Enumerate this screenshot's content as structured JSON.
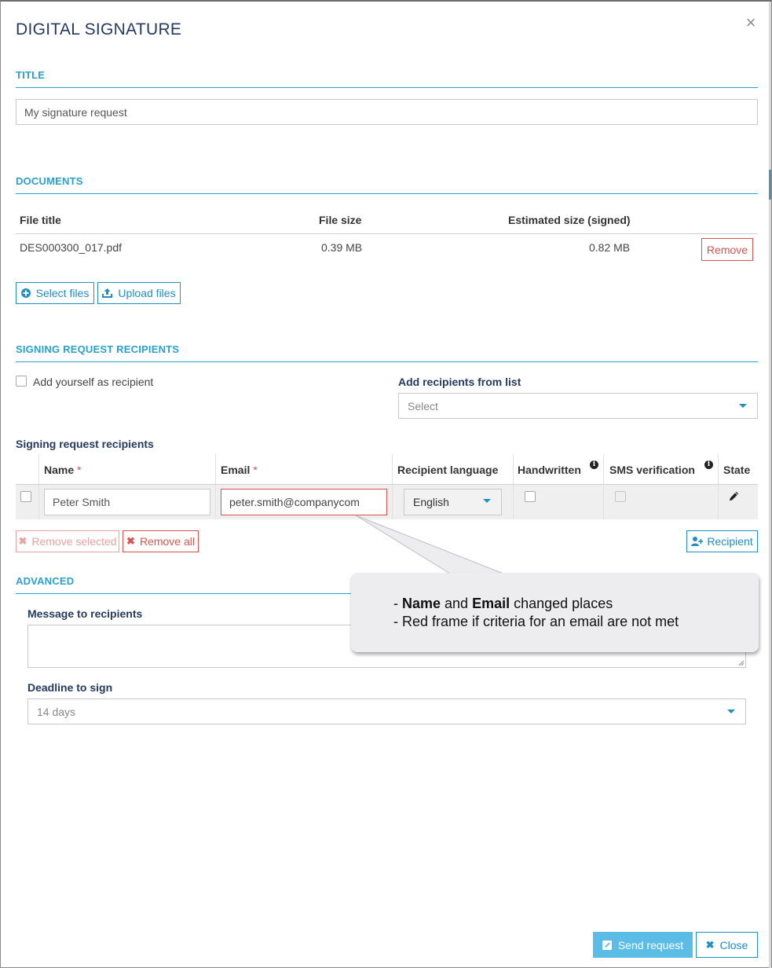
{
  "dialog": {
    "title": "DIGITAL SIGNATURE",
    "close_glyph": "×"
  },
  "title_section": {
    "heading": "TITLE",
    "value": "My signature request"
  },
  "documents": {
    "heading": "DOCUMENTS",
    "columns": {
      "file_title": "File title",
      "file_size": "File size",
      "estimated_size": "Estimated size (signed)"
    },
    "rows": [
      {
        "file_title": "DES000300_017.pdf",
        "file_size": "0.39 MB",
        "estimated_size": "0.82 MB",
        "remove_label": "Remove"
      }
    ],
    "select_files_label": "Select files",
    "upload_files_label": "Upload files"
  },
  "recipients_section": {
    "heading": "SIGNING REQUEST RECIPIENTS",
    "add_yourself_label": "Add yourself as recipient",
    "add_from_list_label": "Add recipients from list",
    "add_from_list_placeholder": "Select",
    "table_title": "Signing request recipients",
    "columns": {
      "name": "Name",
      "email": "Email",
      "required_mark": "*",
      "language": "Recipient language",
      "handwritten": "Handwritten",
      "sms": "SMS verification",
      "state": "State"
    },
    "rows": [
      {
        "name": "Peter Smith",
        "email": "peter.smith@companycom",
        "language": "English"
      }
    ],
    "remove_selected_label": "Remove selected",
    "remove_all_label": "Remove all",
    "add_recipient_label": "Recipient"
  },
  "advanced": {
    "heading": "ADVANCED",
    "message_label": "Message to recipients",
    "message_value": "",
    "deadline_label": "Deadline to sign",
    "deadline_value": "14 days"
  },
  "callout": {
    "line1_prefix": "- ",
    "line1_bold1": "Name",
    "line1_mid": " and ",
    "line1_bold2": "Email",
    "line1_suffix": " changed places",
    "line2": "- Red frame if criteria for an email are not met"
  },
  "footer": {
    "send_label": "Send request",
    "close_label": "Close"
  },
  "colors": {
    "accent": "#1f8fc4",
    "section_heading": "#2aa0cf",
    "danger": "#d9534f",
    "title_dark": "#243a5e",
    "send_bg": "#5bbde6"
  }
}
